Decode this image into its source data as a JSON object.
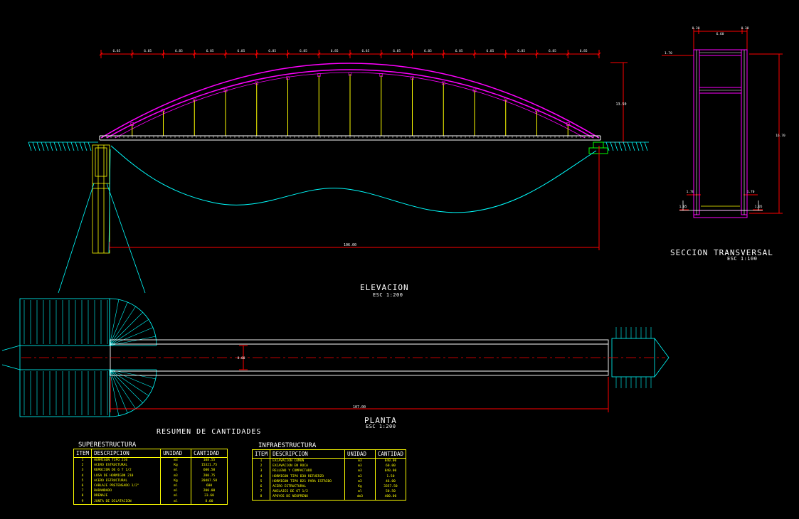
{
  "views": {
    "elevacion": {
      "title": "ELEVACION",
      "scale": "ESC 1:200"
    },
    "seccion": {
      "title": "SECCION TRANSVERSAL",
      "scale": "ESC 1:100"
    },
    "planta": {
      "title": "PLANTA",
      "scale": "ESC 1:200"
    }
  },
  "dimensions": {
    "panel": "6.85",
    "panel_count": 16,
    "arch_height": "13.50",
    "span": "106.00",
    "plan_length": "107.00",
    "plan_width": "8.00",
    "section_width": "6.60",
    "section_edge": "0.30",
    "section_height": "16.70",
    "section_label_a": "1.70",
    "section_label_b": "1.05"
  },
  "summary_title": "RESUMEN DE CANTIDADES",
  "tables": {
    "super": {
      "title": "SUPERESTRUCTURA",
      "headers": [
        "ITEM",
        "DESCRIPCION",
        "UNIDAD",
        "CANTIDAD"
      ],
      "rows": [
        [
          "1",
          "HORMIGON TIPO 210",
          "m3",
          "108.55"
        ],
        [
          "2",
          "ACERO ESTRUCTURAL",
          "Kg",
          "15321.75"
        ],
        [
          "3",
          "REMOCION DE 6 T 1/2",
          "ml",
          "600.50"
        ],
        [
          "4",
          "LOSA DE HORMIGON 210",
          "m3",
          "200.75"
        ],
        [
          "5",
          "ACERO ESTRUCTURAL",
          "Kg",
          "20487.50"
        ],
        [
          "6",
          "CABLAJE PRETENSADO 1/2\"",
          "ml",
          "600"
        ],
        [
          "7",
          "BARANDADO",
          "ml",
          "200.00"
        ],
        [
          "8",
          "DRENAJE",
          "ml",
          "23.60"
        ],
        [
          "9",
          "JUNTA DE DILATACION",
          "ml",
          "8.00"
        ]
      ]
    },
    "infra": {
      "title": "INFRAESTRUCTURA",
      "headers": [
        "ITEM",
        "DESCRIPCION",
        "UNIDAD",
        "CANTIDAD"
      ],
      "rows": [
        [
          "1",
          "EXCAVACION COMUN",
          "m3",
          "840.00"
        ],
        [
          "2",
          "EXCAVACION EN ROCA",
          "m3",
          "60.00"
        ],
        [
          "3",
          "RELLENO Y COMPACTADO",
          "m3",
          "840.00"
        ],
        [
          "4",
          "HORMIGON TIPO B30 REFUERZO",
          "m3",
          "1.50"
        ],
        [
          "5",
          "HORMIGON TIPO B21 PARA ESTRIBO",
          "m3",
          "46.00"
        ],
        [
          "6",
          "ACERO ESTRUCTURAL",
          "Kg",
          "3357.50"
        ],
        [
          "7",
          "ANCLAJES DE 6T 1/2",
          "ml",
          "50.50"
        ],
        [
          "8",
          "APOYOS DE NEOPRENO",
          "dm3",
          "400.00"
        ]
      ]
    }
  },
  "colors": {
    "background": "#000000",
    "dimension": "#ff0000",
    "arch": "#ff00ff",
    "deck": "#ffffff",
    "hangers": "#ffff00",
    "terrain": "#00ffff",
    "pier": "#ffff00",
    "ground": "#00ffff",
    "abutment": "#00ff00"
  }
}
